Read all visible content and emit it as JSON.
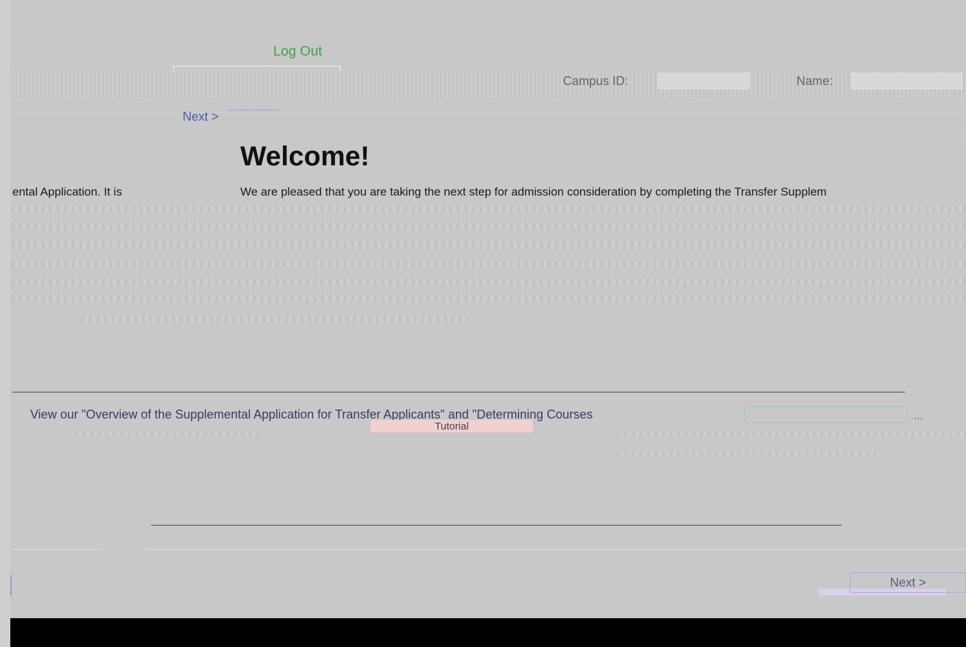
{
  "header": {
    "title": "",
    "logout_label": "Log Out"
  },
  "status": {
    "campus_id_label": "Campus ID:",
    "name_label": "Name:"
  },
  "nav": {
    "next_label": "Next >"
  },
  "main": {
    "heading": "Welcome!",
    "intro_left": "ental Application. It is",
    "intro_right": "We are pleased that you are taking the next step for admission consideration by completing the Transfer Supplem",
    "overview_text": "View our \"Overview of the Supplemental Application for Transfer Applicants\" and \"Determining Courses",
    "tutorial_label": "Tutorial"
  },
  "footer": {
    "next_label": "Next >"
  }
}
